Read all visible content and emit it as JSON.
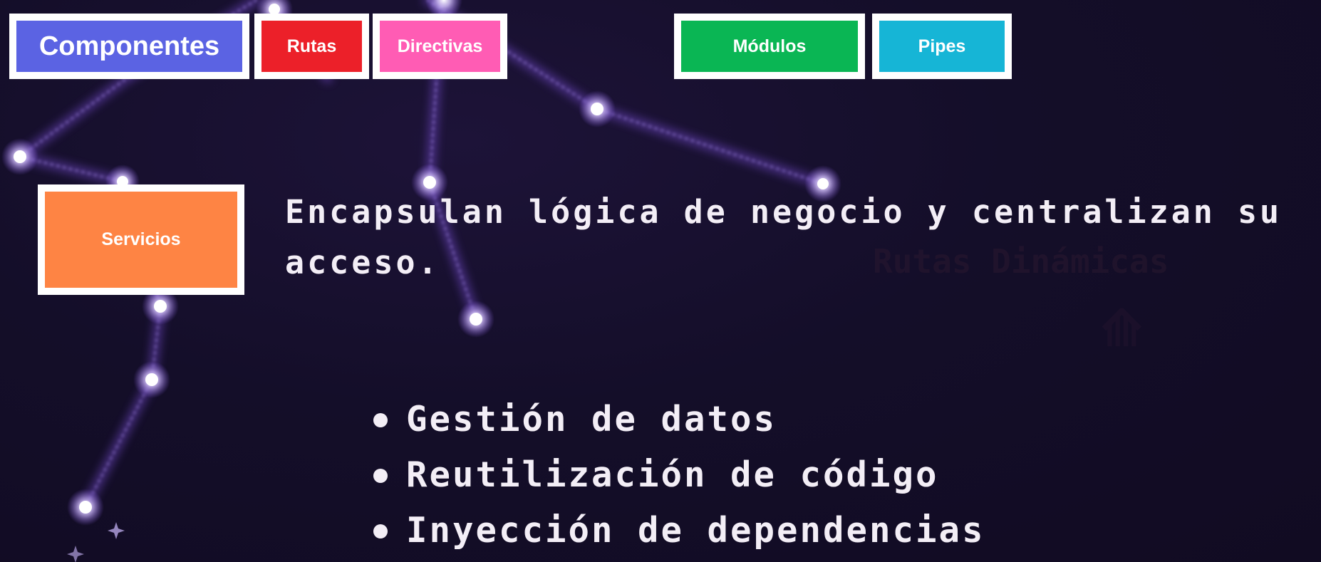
{
  "nav": {
    "components": "Componentes",
    "routes": "Rutas",
    "directives": "Directivas",
    "modules": "Módulos",
    "pipes": "Pipes"
  },
  "active": {
    "label": "Servicios"
  },
  "description": "Encapsulan lógica de negocio y centralizan su acceso.",
  "features": [
    "Gestión de datos",
    "Reutilización de código",
    "Inyección de dependencias"
  ],
  "colors": {
    "background": "#130d26",
    "components": "#5b63e3",
    "routes": "#ec2029",
    "directives": "#ff5cb4",
    "modules": "#0ab654",
    "pipes": "#16b5d6",
    "services": "#fe8444",
    "text": "#f3eef6",
    "glow": "#9a6cf2"
  }
}
